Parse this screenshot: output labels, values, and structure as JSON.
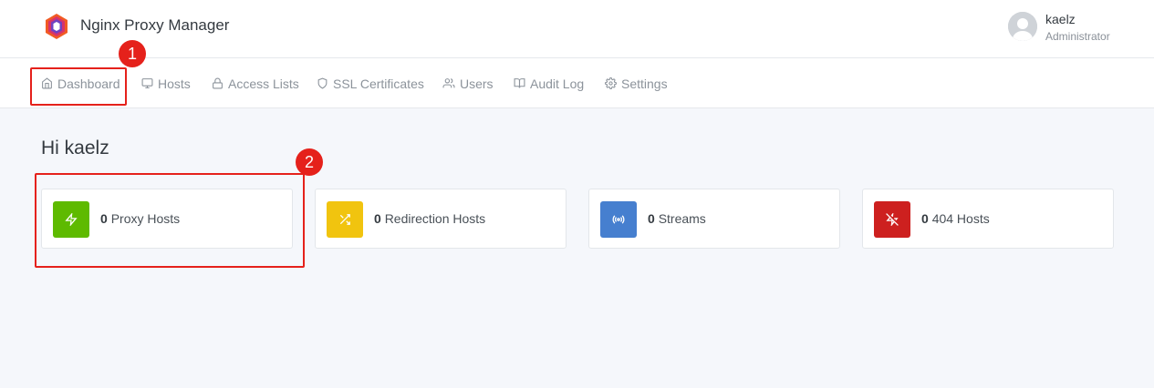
{
  "app": {
    "title": "Nginx Proxy Manager"
  },
  "user": {
    "name": "kaelz",
    "role": "Administrator"
  },
  "nav": {
    "items": [
      {
        "label": "Dashboard",
        "icon": "home-icon"
      },
      {
        "label": "Hosts",
        "icon": "monitor-icon"
      },
      {
        "label": "Access Lists",
        "icon": "lock-icon"
      },
      {
        "label": "SSL Certificates",
        "icon": "shield-icon"
      },
      {
        "label": "Users",
        "icon": "users-icon"
      },
      {
        "label": "Audit Log",
        "icon": "book-icon"
      },
      {
        "label": "Settings",
        "icon": "gear-icon"
      }
    ],
    "active": "Dashboard"
  },
  "main": {
    "greeting": "Hi kaelz",
    "cards": [
      {
        "count": "0",
        "label": "Proxy Hosts",
        "icon": "zap-icon",
        "color": "#5eba00"
      },
      {
        "count": "0",
        "label": "Redirection Hosts",
        "icon": "shuffle-icon",
        "color": "#f1c40f"
      },
      {
        "count": "0",
        "label": "Streams",
        "icon": "radio-icon",
        "color": "#467fcf"
      },
      {
        "count": "0",
        "label": "404 Hosts",
        "icon": "zap-off-icon",
        "color": "#cd201f"
      }
    ]
  },
  "annotations": [
    {
      "label": "1"
    },
    {
      "label": "2"
    }
  ]
}
